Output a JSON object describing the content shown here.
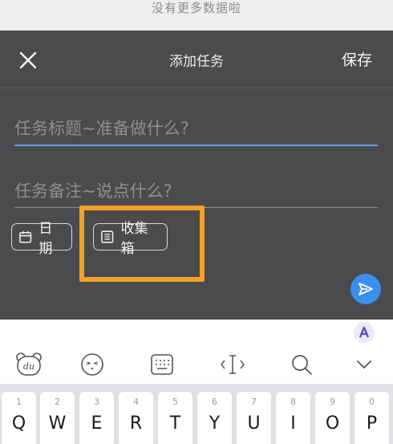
{
  "top_notice": "没有更多数据啦",
  "header": {
    "title": "添加任务",
    "save_label": "保存"
  },
  "form": {
    "title_placeholder": "任务标题~准备做什么?",
    "note_placeholder": "任务备注~说点什么?"
  },
  "chips": {
    "date_label": "日期",
    "inbox_label": "收集箱"
  },
  "colors": {
    "panel": "#4b4b4d",
    "accent": "#3b8ff0",
    "highlight": "#f4a12b"
  },
  "keyboard": {
    "toolbar_icons": [
      "du-bear-icon",
      "emoji-icon",
      "keyboard-icon",
      "cursor-icon",
      "search-icon",
      "collapse-icon"
    ],
    "keys": [
      {
        "num": "1",
        "letter": "Q"
      },
      {
        "num": "2",
        "letter": "W"
      },
      {
        "num": "3",
        "letter": "E"
      },
      {
        "num": "4",
        "letter": "R"
      },
      {
        "num": "5",
        "letter": "T"
      },
      {
        "num": "6",
        "letter": "Y"
      },
      {
        "num": "7",
        "letter": "U"
      },
      {
        "num": "8",
        "letter": "I"
      },
      {
        "num": "9",
        "letter": "O"
      },
      {
        "num": "0",
        "letter": "P"
      }
    ]
  }
}
